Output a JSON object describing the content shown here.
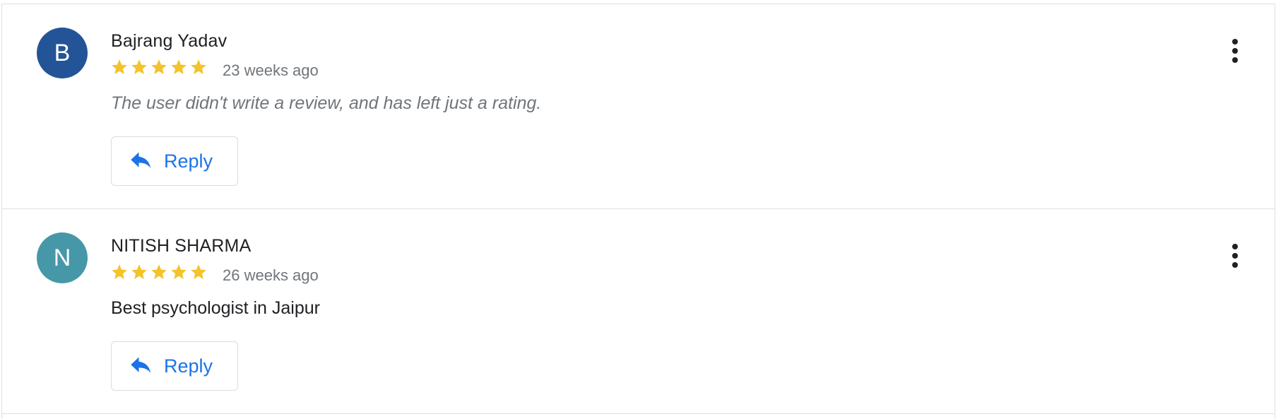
{
  "colors": {
    "star": "#f4c32b",
    "reply_accent": "#1a73e8",
    "avatar_b": "#245498",
    "avatar_n": "#4698a8"
  },
  "reviews": [
    {
      "avatar_letter": "B",
      "avatar_color": "#245498",
      "name": "Bajrang Yadav",
      "rating": 5,
      "time": "23 weeks ago",
      "text": "The user didn't write a review, and has left just a rating.",
      "text_is_placeholder": true,
      "reply_label": "Reply",
      "icons": {
        "reply": "reply-arrow-icon",
        "more": "more-vert-icon",
        "star": "star-icon"
      }
    },
    {
      "avatar_letter": "N",
      "avatar_color": "#4698a8",
      "name": "NITISH SHARMA",
      "rating": 5,
      "time": "26 weeks ago",
      "text": "Best psychologist in Jaipur",
      "text_is_placeholder": false,
      "reply_label": "Reply",
      "icons": {
        "reply": "reply-arrow-icon",
        "more": "more-vert-icon",
        "star": "star-icon"
      }
    }
  ]
}
